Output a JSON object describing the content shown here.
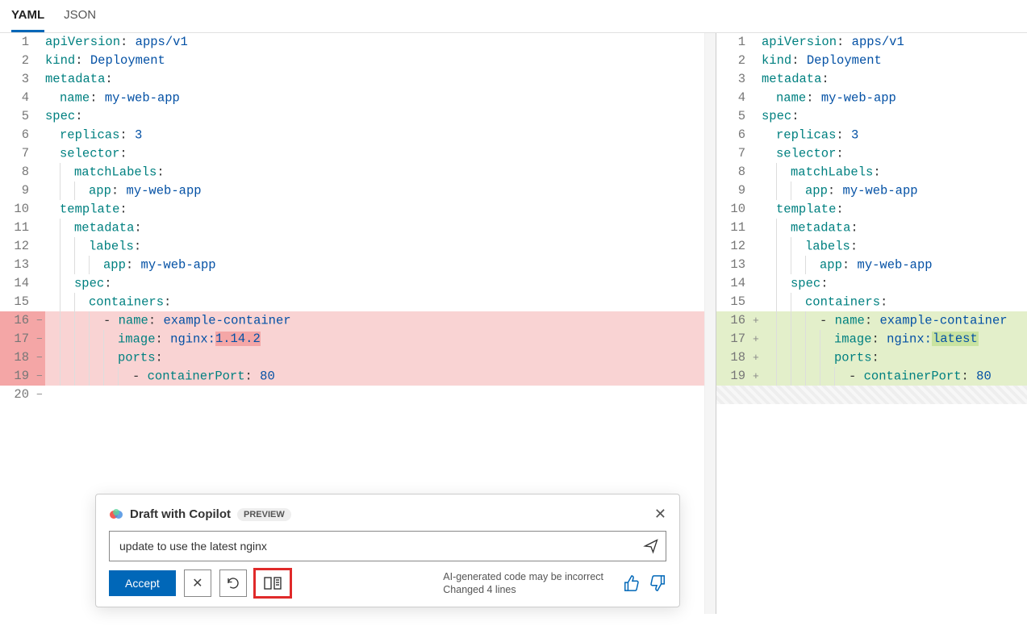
{
  "tabs": {
    "yaml": "YAML",
    "json": "JSON",
    "active": "yaml"
  },
  "left": {
    "lines": [
      {
        "n": 1,
        "indent": 0,
        "removed": false,
        "tokens": [
          [
            "t-key",
            "apiVersion"
          ],
          [
            "",
            ":"
          ],
          [
            "",
            " "
          ],
          [
            "t-str",
            "apps/v1"
          ]
        ]
      },
      {
        "n": 2,
        "indent": 0,
        "removed": false,
        "tokens": [
          [
            "t-key",
            "kind"
          ],
          [
            "",
            ":"
          ],
          [
            "",
            " "
          ],
          [
            "t-str",
            "Deployment"
          ]
        ]
      },
      {
        "n": 3,
        "indent": 0,
        "removed": false,
        "tokens": [
          [
            "t-key",
            "metadata"
          ],
          [
            "",
            ":"
          ]
        ]
      },
      {
        "n": 4,
        "indent": 1,
        "removed": false,
        "tokens": [
          [
            "t-key",
            "name"
          ],
          [
            "",
            ":"
          ],
          [
            "",
            " "
          ],
          [
            "t-str",
            "my-web-app"
          ]
        ]
      },
      {
        "n": 5,
        "indent": 0,
        "removed": false,
        "tokens": [
          [
            "t-key",
            "spec"
          ],
          [
            "",
            ":"
          ]
        ]
      },
      {
        "n": 6,
        "indent": 1,
        "removed": false,
        "tokens": [
          [
            "t-key",
            "replicas"
          ],
          [
            "",
            ":"
          ],
          [
            "",
            " "
          ],
          [
            "t-str",
            "3"
          ]
        ]
      },
      {
        "n": 7,
        "indent": 1,
        "removed": false,
        "tokens": [
          [
            "t-key",
            "selector"
          ],
          [
            "",
            ":"
          ]
        ]
      },
      {
        "n": 8,
        "indent": 2,
        "removed": false,
        "tokens": [
          [
            "t-key",
            "matchLabels"
          ],
          [
            "",
            ":"
          ]
        ]
      },
      {
        "n": 9,
        "indent": 3,
        "removed": false,
        "tokens": [
          [
            "t-key",
            "app"
          ],
          [
            "",
            ":"
          ],
          [
            "",
            " "
          ],
          [
            "t-str",
            "my-web-app"
          ]
        ]
      },
      {
        "n": 10,
        "indent": 1,
        "removed": false,
        "tokens": [
          [
            "t-key",
            "template"
          ],
          [
            "",
            ":"
          ]
        ]
      },
      {
        "n": 11,
        "indent": 2,
        "removed": false,
        "tokens": [
          [
            "t-key",
            "metadata"
          ],
          [
            "",
            ":"
          ]
        ]
      },
      {
        "n": 12,
        "indent": 3,
        "removed": false,
        "tokens": [
          [
            "t-key",
            "labels"
          ],
          [
            "",
            ":"
          ]
        ]
      },
      {
        "n": 13,
        "indent": 4,
        "removed": false,
        "tokens": [
          [
            "t-key",
            "app"
          ],
          [
            "",
            ":"
          ],
          [
            "",
            " "
          ],
          [
            "t-str",
            "my-web-app"
          ]
        ]
      },
      {
        "n": 14,
        "indent": 2,
        "removed": false,
        "tokens": [
          [
            "t-key",
            "spec"
          ],
          [
            "",
            ":"
          ]
        ]
      },
      {
        "n": 15,
        "indent": 3,
        "removed": false,
        "tokens": [
          [
            "t-key",
            "containers"
          ],
          [
            "",
            ":"
          ]
        ]
      },
      {
        "n": 16,
        "indent": 4,
        "removed": true,
        "sign": "−",
        "tokens": [
          [
            "",
            "- "
          ],
          [
            "t-key",
            "name"
          ],
          [
            "",
            ":"
          ],
          [
            "",
            " "
          ],
          [
            "t-str",
            "example-container"
          ]
        ]
      },
      {
        "n": 17,
        "indent": 5,
        "removed": true,
        "sign": "−",
        "tokens": [
          [
            "t-key",
            "image"
          ],
          [
            "",
            ":"
          ],
          [
            "",
            " "
          ],
          [
            "t-str",
            "nginx:"
          ],
          [
            "t-str removed-inline",
            "1.14.2"
          ]
        ]
      },
      {
        "n": 18,
        "indent": 5,
        "removed": true,
        "sign": "−",
        "tokens": [
          [
            "t-key",
            "ports"
          ],
          [
            "",
            ":"
          ]
        ]
      },
      {
        "n": 19,
        "indent": 6,
        "removed": true,
        "sign": "−",
        "tokens": [
          [
            "",
            "- "
          ],
          [
            "t-key",
            "containerPort"
          ],
          [
            "",
            ":"
          ],
          [
            "",
            " "
          ],
          [
            "t-str",
            "80"
          ]
        ]
      },
      {
        "n": 20,
        "indent": 0,
        "removed": false,
        "sign": "−",
        "tokens": []
      }
    ]
  },
  "right": {
    "lines": [
      {
        "n": 1,
        "indent": 0,
        "added": false,
        "tokens": [
          [
            "t-key",
            "apiVersion"
          ],
          [
            "",
            ":"
          ],
          [
            "",
            " "
          ],
          [
            "t-str",
            "apps/v1"
          ]
        ]
      },
      {
        "n": 2,
        "indent": 0,
        "added": false,
        "tokens": [
          [
            "t-key",
            "kind"
          ],
          [
            "",
            ":"
          ],
          [
            "",
            " "
          ],
          [
            "t-str",
            "Deployment"
          ]
        ]
      },
      {
        "n": 3,
        "indent": 0,
        "added": false,
        "tokens": [
          [
            "t-key",
            "metadata"
          ],
          [
            "",
            ":"
          ]
        ]
      },
      {
        "n": 4,
        "indent": 1,
        "added": false,
        "tokens": [
          [
            "t-key",
            "name"
          ],
          [
            "",
            ":"
          ],
          [
            "",
            " "
          ],
          [
            "t-str",
            "my-web-app"
          ]
        ]
      },
      {
        "n": 5,
        "indent": 0,
        "added": false,
        "tokens": [
          [
            "t-key",
            "spec"
          ],
          [
            "",
            ":"
          ]
        ]
      },
      {
        "n": 6,
        "indent": 1,
        "added": false,
        "tokens": [
          [
            "t-key",
            "replicas"
          ],
          [
            "",
            ":"
          ],
          [
            "",
            " "
          ],
          [
            "t-str",
            "3"
          ]
        ]
      },
      {
        "n": 7,
        "indent": 1,
        "added": false,
        "tokens": [
          [
            "t-key",
            "selector"
          ],
          [
            "",
            ":"
          ]
        ]
      },
      {
        "n": 8,
        "indent": 2,
        "added": false,
        "tokens": [
          [
            "t-key",
            "matchLabels"
          ],
          [
            "",
            ":"
          ]
        ]
      },
      {
        "n": 9,
        "indent": 3,
        "added": false,
        "tokens": [
          [
            "t-key",
            "app"
          ],
          [
            "",
            ":"
          ],
          [
            "",
            " "
          ],
          [
            "t-str",
            "my-web-app"
          ]
        ]
      },
      {
        "n": 10,
        "indent": 1,
        "added": false,
        "tokens": [
          [
            "t-key",
            "template"
          ],
          [
            "",
            ":"
          ]
        ]
      },
      {
        "n": 11,
        "indent": 2,
        "added": false,
        "tokens": [
          [
            "t-key",
            "metadata"
          ],
          [
            "",
            ":"
          ]
        ]
      },
      {
        "n": 12,
        "indent": 3,
        "added": false,
        "tokens": [
          [
            "t-key",
            "labels"
          ],
          [
            "",
            ":"
          ]
        ]
      },
      {
        "n": 13,
        "indent": 4,
        "added": false,
        "tokens": [
          [
            "t-key",
            "app"
          ],
          [
            "",
            ":"
          ],
          [
            "",
            " "
          ],
          [
            "t-str",
            "my-web-app"
          ]
        ]
      },
      {
        "n": 14,
        "indent": 2,
        "added": false,
        "tokens": [
          [
            "t-key",
            "spec"
          ],
          [
            "",
            ":"
          ]
        ]
      },
      {
        "n": 15,
        "indent": 3,
        "added": false,
        "tokens": [
          [
            "t-key",
            "containers"
          ],
          [
            "",
            ":"
          ]
        ]
      },
      {
        "n": 16,
        "indent": 4,
        "added": true,
        "sign": "+",
        "tokens": [
          [
            "",
            "- "
          ],
          [
            "t-key",
            "name"
          ],
          [
            "",
            ":"
          ],
          [
            "",
            " "
          ],
          [
            "t-str",
            "example-container"
          ]
        ]
      },
      {
        "n": 17,
        "indent": 5,
        "added": true,
        "sign": "+",
        "tokens": [
          [
            "t-key",
            "image"
          ],
          [
            "",
            ":"
          ],
          [
            "",
            " "
          ],
          [
            "t-str",
            "nginx:"
          ],
          [
            "t-str added-inline",
            "latest"
          ]
        ]
      },
      {
        "n": 18,
        "indent": 5,
        "added": true,
        "sign": "+",
        "tokens": [
          [
            "t-key",
            "ports"
          ],
          [
            "",
            ":"
          ]
        ]
      },
      {
        "n": 19,
        "indent": 6,
        "added": true,
        "sign": "+",
        "tokens": [
          [
            "",
            "- "
          ],
          [
            "t-key",
            "containerPort"
          ],
          [
            "",
            ":"
          ],
          [
            "",
            " "
          ],
          [
            "t-str",
            "80"
          ]
        ]
      }
    ],
    "hatch": true
  },
  "copilot": {
    "title": "Draft with Copilot",
    "badge": "PREVIEW",
    "prompt": "update to use the latest nginx",
    "accept": "Accept",
    "warn1": "AI-generated code may be incorrect",
    "warn2": "Changed 4 lines"
  }
}
